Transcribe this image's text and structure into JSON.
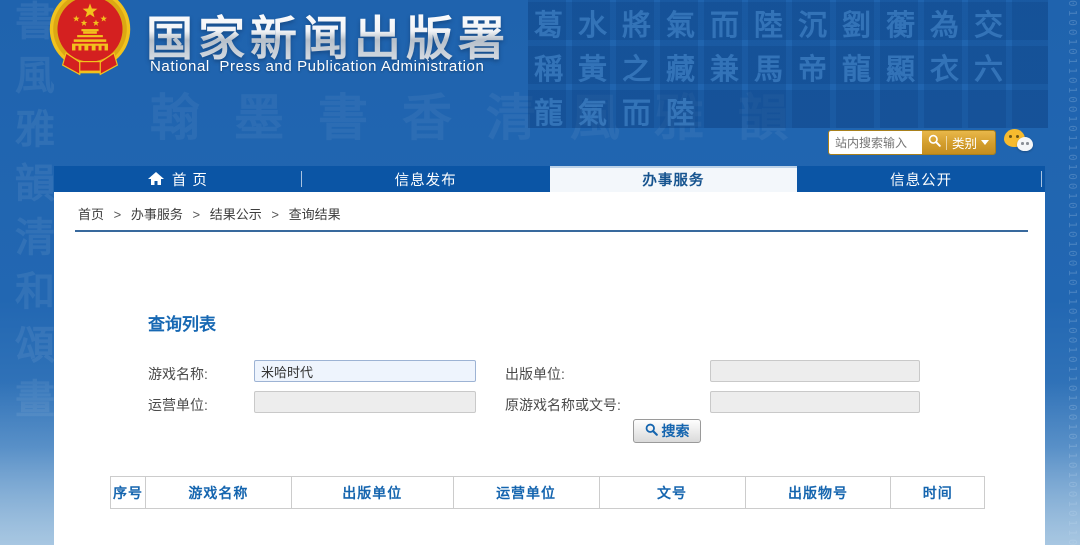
{
  "header": {
    "title": "国家新闻出版署",
    "subtitle": "National  Press and Publication Administration",
    "search": {
      "placeholder": "站内搜索输入",
      "category": "类别"
    }
  },
  "nav": {
    "items": [
      {
        "label": "首 页",
        "icon": "home-icon",
        "active": false
      },
      {
        "label": "信息发布",
        "active": false
      },
      {
        "label": "办事服务",
        "active": true
      },
      {
        "label": "信息公开",
        "active": false
      }
    ]
  },
  "breadcrumb": {
    "separator": ">",
    "items": [
      "首页",
      "办事服务",
      "结果公示",
      "查询结果"
    ]
  },
  "main": {
    "heading": "查询列表",
    "form": {
      "fields": [
        {
          "label": "游戏名称:",
          "value": "米哈时代",
          "filled": true
        },
        {
          "label": "出版单位:",
          "value": "",
          "filled": false
        },
        {
          "label": "运营单位:",
          "value": "",
          "filled": false
        },
        {
          "label": "原游戏名称或文号:",
          "value": "",
          "filled": false
        }
      ],
      "search_button": "搜索"
    },
    "table": {
      "headers": [
        "序号",
        "游戏名称",
        "出版单位",
        "运营单位",
        "文号",
        "出版物号",
        "时间"
      ],
      "rows": []
    }
  },
  "background": {
    "left_watermark": "書風雅韻清和頌畫",
    "header_watermark": "翰墨書香清風雅韻",
    "tile_chars": "葛水將氣而陸沉劉蘅為交稱黃之藏兼馬帝龍顯衣六龍氣而陸",
    "binary_texture": "0100101101001011010010110100101101001011010010110100101101001011010010110100101101001011"
  },
  "colors": {
    "header_blue": "#2166b1",
    "nav_blue": "#0b55a5",
    "active_tab_bg": "#f3f7fb",
    "accent_blue": "#1565af",
    "gold": "#d39d2c",
    "rule_blue": "#38699d",
    "filled_input_bg": "#eef4fd",
    "empty_input_bg": "#ededed"
  }
}
